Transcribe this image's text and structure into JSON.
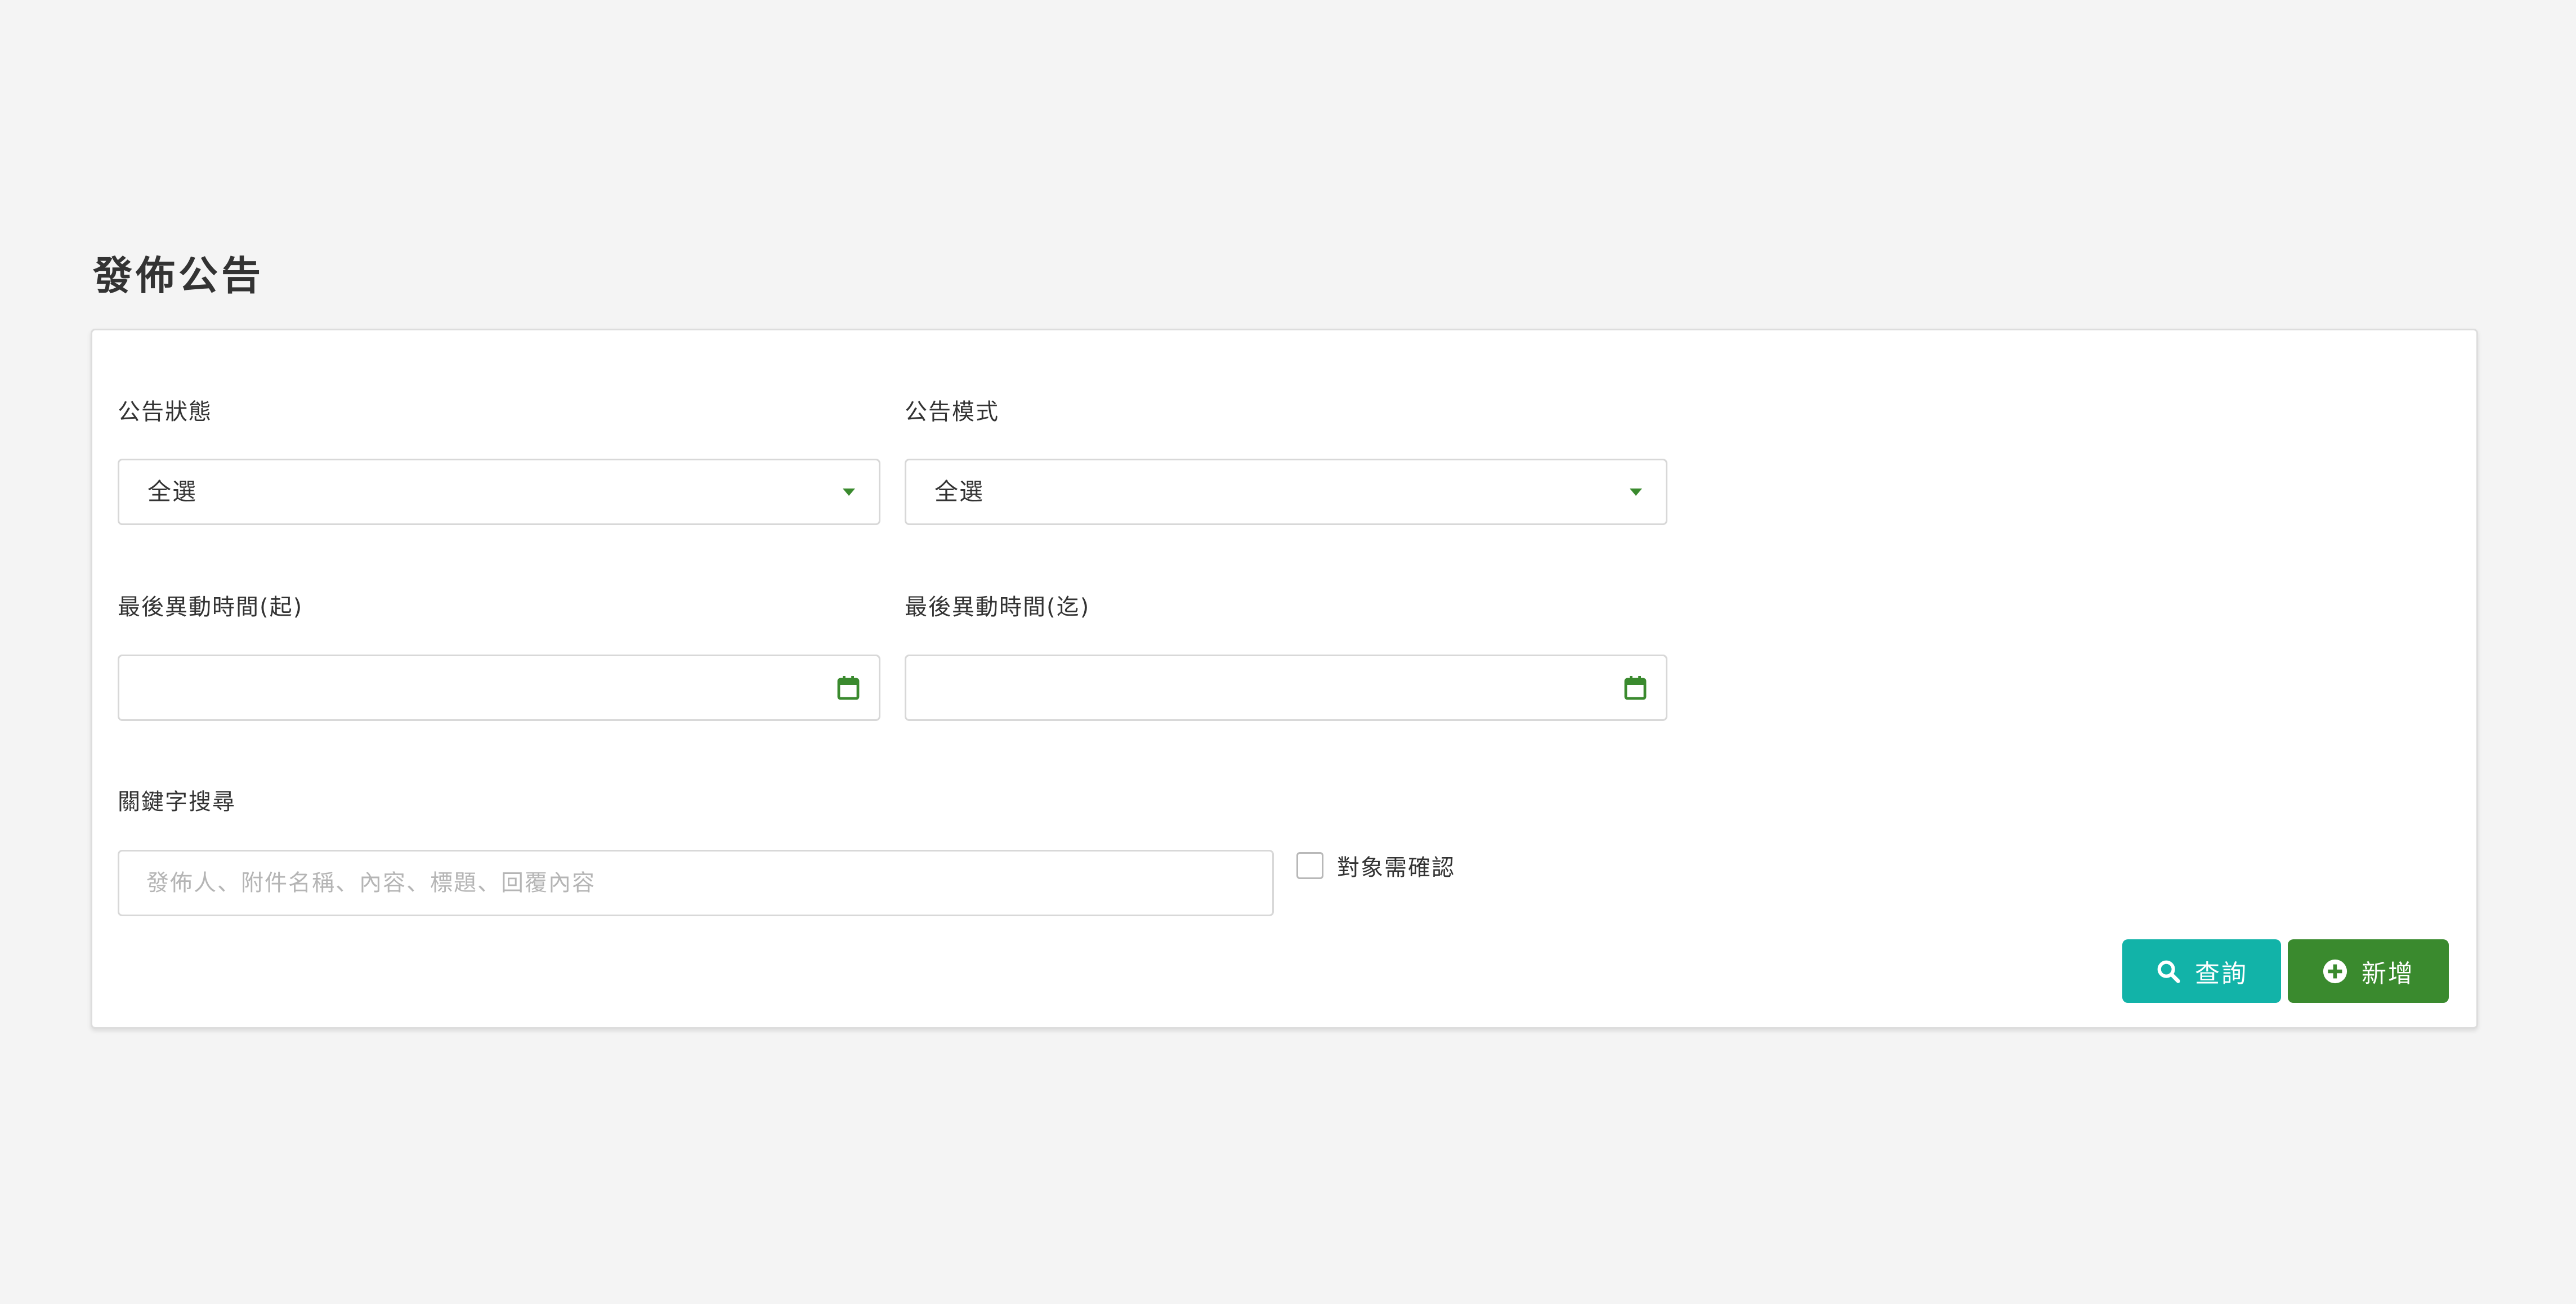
{
  "page": {
    "title": "發佈公告"
  },
  "filters": {
    "status": {
      "label": "公告狀態",
      "selected": "全選"
    },
    "mode": {
      "label": "公告模式",
      "selected": "全選"
    },
    "modified_from": {
      "label": "最後異動時間(起)",
      "value": ""
    },
    "modified_to": {
      "label": "最後異動時間(迄)",
      "value": ""
    },
    "keyword": {
      "label": "關鍵字搜尋",
      "placeholder": "發佈人、附件名稱、內容、標題、回覆內容",
      "value": ""
    },
    "needs_confirmation": {
      "label": "對象需確認",
      "checked": false
    }
  },
  "actions": {
    "query_label": "查詢",
    "add_label": "新增"
  },
  "icons": {
    "dropdown": "caret-down-icon",
    "date": "calendar-icon",
    "query": "search-icon",
    "add": "plus-circle-icon"
  },
  "colors": {
    "accent_green": "#3a8a2e",
    "teal": "#12b3a8",
    "background": "#f4f4f4"
  }
}
